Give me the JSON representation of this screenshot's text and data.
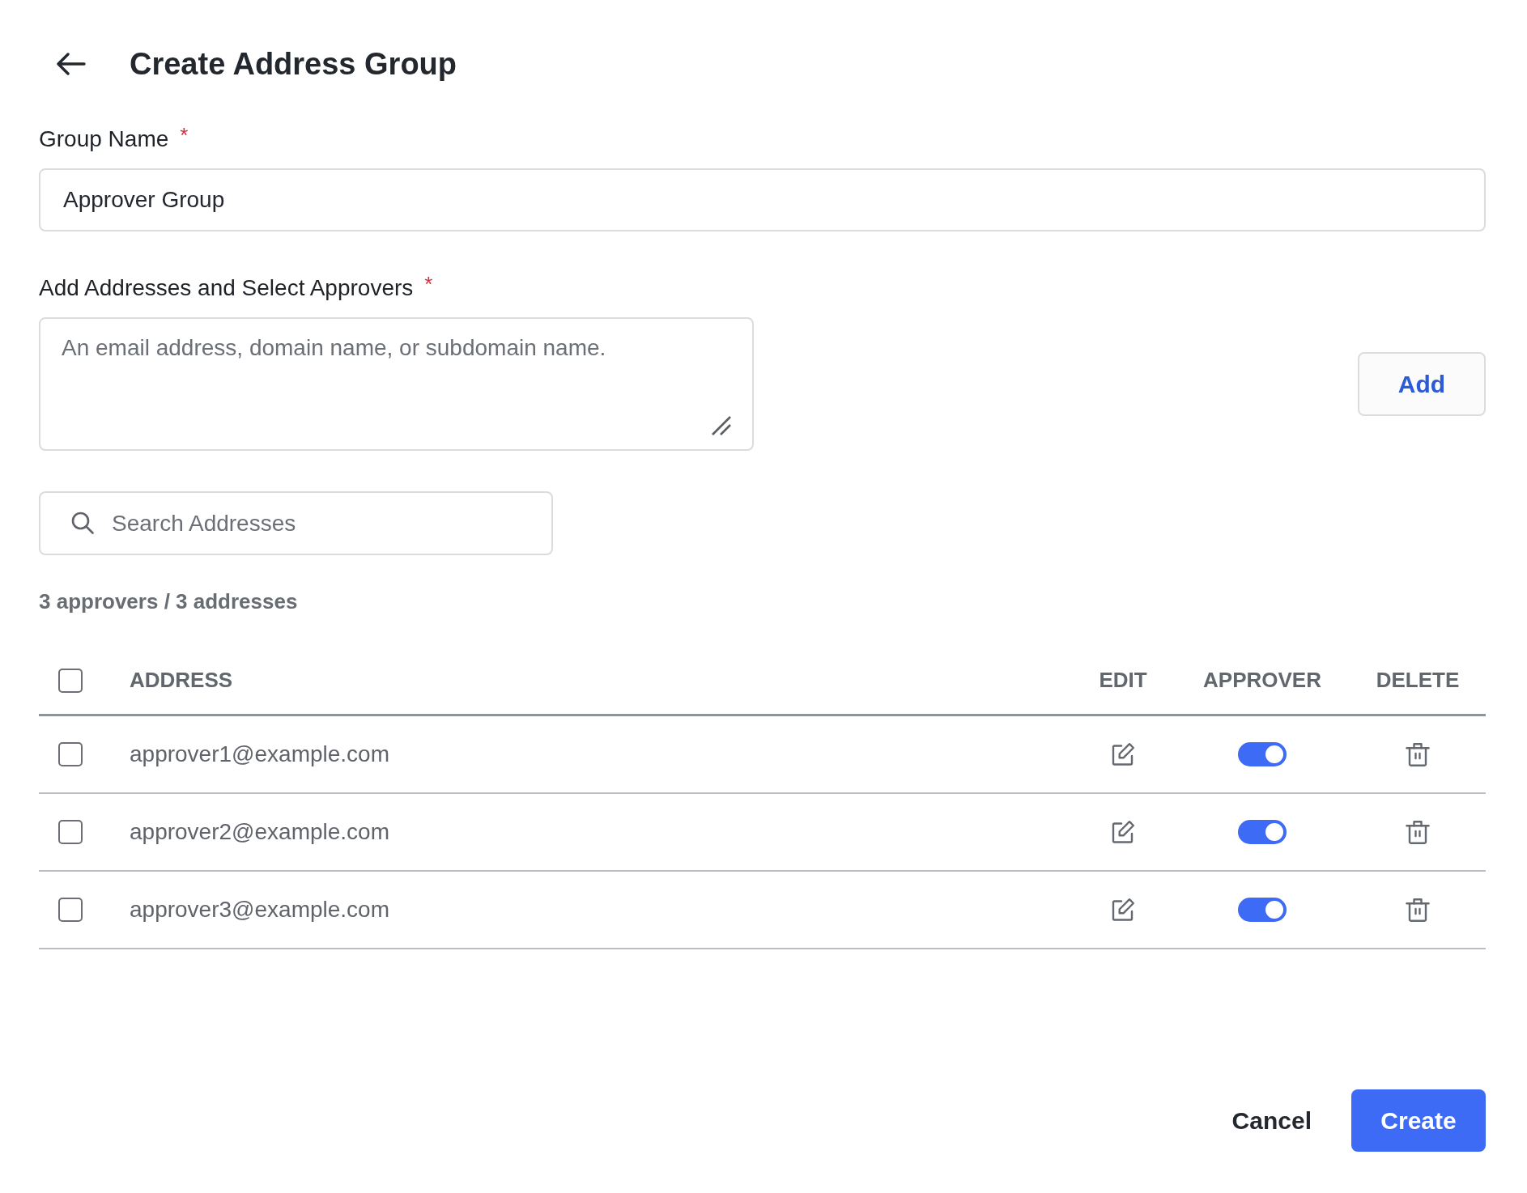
{
  "header": {
    "title": "Create Address Group"
  },
  "group_name": {
    "label": "Group Name",
    "required_mark": "*",
    "value": "Approver Group"
  },
  "addresses": {
    "label": "Add Addresses and Select Approvers",
    "required_mark": "*",
    "placeholder": "An email address, domain name, or subdomain name.",
    "add_button": "Add"
  },
  "search": {
    "placeholder": "Search Addresses"
  },
  "summary": "3 approvers / 3 addresses",
  "table": {
    "all_checked": false,
    "columns": [
      "ADDRESS",
      "EDIT",
      "APPROVER",
      "DELETE"
    ],
    "rows": [
      {
        "checked": false,
        "address": "approver1@example.com",
        "approver": true
      },
      {
        "checked": false,
        "address": "approver2@example.com",
        "approver": true
      },
      {
        "checked": false,
        "address": "approver3@example.com",
        "approver": true
      }
    ]
  },
  "actions": {
    "cancel": "Cancel",
    "create": "Create"
  }
}
